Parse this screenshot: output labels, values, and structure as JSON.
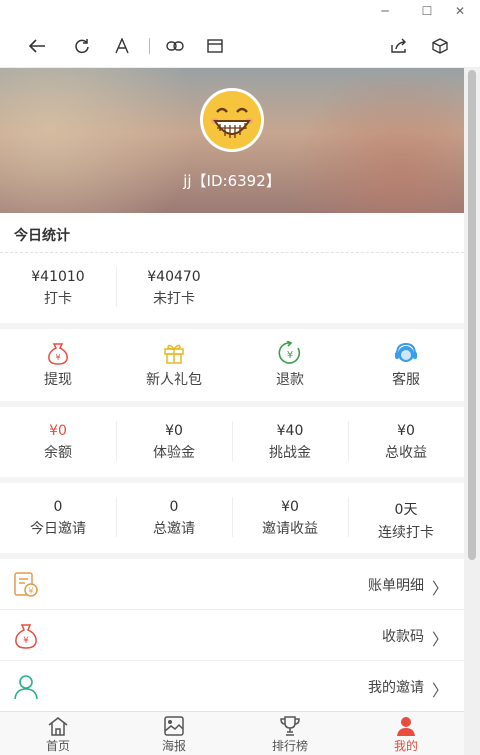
{
  "window": {
    "minimize": "─",
    "maximize": "☐",
    "close": "✕"
  },
  "profile": {
    "username": "jj【ID:6392】"
  },
  "today": {
    "title": "今日统计",
    "stats": [
      {
        "value": "¥41010",
        "label": "打卡"
      },
      {
        "value": "¥40470",
        "label": "未打卡"
      }
    ]
  },
  "features": [
    {
      "label": "提现",
      "icon": "money-bag-icon"
    },
    {
      "label": "新人礼包",
      "icon": "gift-icon"
    },
    {
      "label": "退款",
      "icon": "refund-icon"
    },
    {
      "label": "客服",
      "icon": "customer-service-icon"
    }
  ],
  "balance": [
    {
      "value": "¥0",
      "label": "余额",
      "color": "#e84c3d"
    },
    {
      "value": "¥0",
      "label": "体验金"
    },
    {
      "value": "¥40",
      "label": "挑战金"
    },
    {
      "value": "¥0",
      "label": "总收益"
    }
  ],
  "invites": [
    {
      "value": "0",
      "label": "今日邀请"
    },
    {
      "value": "0",
      "label": "总邀请"
    },
    {
      "value": "¥0",
      "label": "邀请收益"
    },
    {
      "value": "0天",
      "label": "连续打卡"
    }
  ],
  "menu": [
    {
      "label": "账单明细",
      "icon": "bill-icon"
    },
    {
      "label": "收款码",
      "icon": "money-bag-icon"
    },
    {
      "label": "我的邀请",
      "icon": "user-icon"
    }
  ],
  "chevron": "〉",
  "tabs": [
    {
      "label": "首页",
      "icon": "home-icon"
    },
    {
      "label": "海报",
      "icon": "poster-icon"
    },
    {
      "label": "排行榜",
      "icon": "trophy-icon"
    },
    {
      "label": "我的",
      "icon": "profile-icon",
      "active": true
    }
  ],
  "colors": {
    "accent": "#e84c3d",
    "gift": "#e8b923",
    "refund": "#3aa14a",
    "service": "#3a9ee8",
    "invite": "#27b38a"
  }
}
